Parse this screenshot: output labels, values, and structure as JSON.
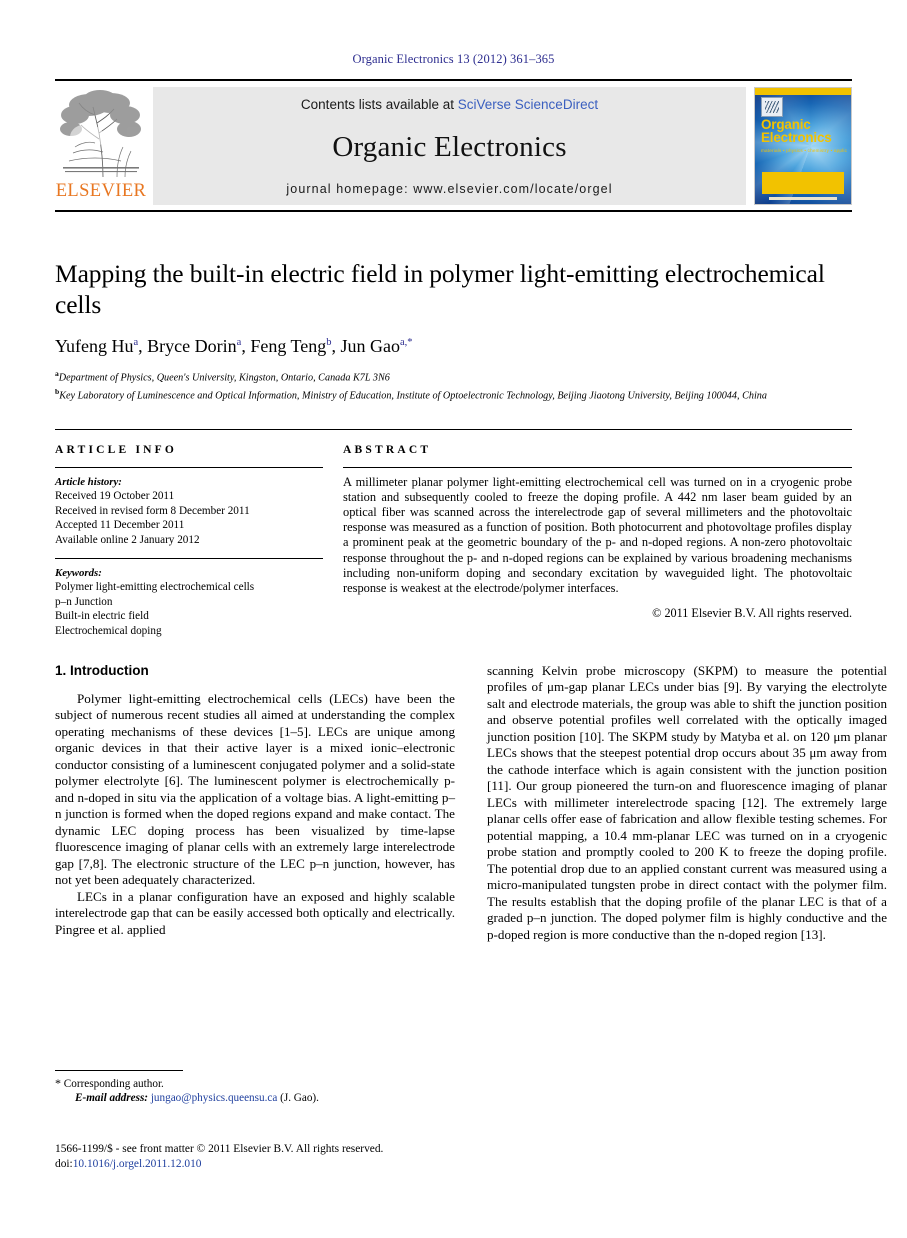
{
  "running_head": "Organic Electronics 13 (2012) 361–365",
  "masthead": {
    "publisher_name": "ELSEVIER",
    "contents_prefix": "Contents lists available at ",
    "contents_link": "SciVerse ScienceDirect",
    "journal_title": "Organic Electronics",
    "homepage_line": "journal homepage: www.elsevier.com/locate/orgel",
    "cover": {
      "title_line1": "Organic",
      "title_line2": "Electronics",
      "subtitle": "materials • physics • chemistry • applications"
    }
  },
  "article": {
    "title": "Mapping the built-in electric field in polymer light-emitting electrochemical cells",
    "authors": [
      {
        "name": "Yufeng Hu",
        "marks": "a",
        "sep": ", "
      },
      {
        "name": "Bryce Dorin",
        "marks": "a",
        "sep": ", "
      },
      {
        "name": "Feng Teng",
        "marks": "b",
        "sep": ", "
      },
      {
        "name": "Jun Gao",
        "marks": "a,*",
        "sep": ""
      }
    ],
    "affiliations": [
      {
        "mark": "a",
        "text": "Department of Physics, Queen's University, Kingston, Ontario, Canada K7L 3N6"
      },
      {
        "mark": "b",
        "text": "Key Laboratory of Luminescence and Optical Information, Ministry of Education, Institute of Optoelectronic Technology, Beijing Jiaotong University, Beijing 100044, China"
      }
    ]
  },
  "article_info": {
    "heading": "ARTICLE INFO",
    "history_label": "Article history:",
    "history": [
      "Received 19 October 2011",
      "Received in revised form 8 December 2011",
      "Accepted 11 December 2011",
      "Available online 2 January 2012"
    ],
    "keywords_label": "Keywords:",
    "keywords": [
      "Polymer light-emitting electrochemical cells",
      "p–n Junction",
      "Built-in electric field",
      "Electrochemical doping"
    ]
  },
  "abstract": {
    "heading": "ABSTRACT",
    "text": "A millimeter planar polymer light-emitting electrochemical cell was turned on in a cryogenic probe station and subsequently cooled to freeze the doping profile. A 442 nm laser beam guided by an optical fiber was scanned across the interelectrode gap of several millimeters and the photovoltaic response was measured as a function of position. Both photocurrent and photovoltage profiles display a prominent peak at the geometric boundary of the p- and n-doped regions. A non-zero photovoltaic response throughout the p- and n-doped regions can be explained by various broadening mechanisms including non-uniform doping and secondary excitation by waveguided light. The photovoltaic response is weakest at the electrode/polymer interfaces.",
    "copyright": "© 2011 Elsevier B.V. All rights reserved."
  },
  "body": {
    "section_title": "1. Introduction",
    "left_paragraphs": [
      "Polymer light-emitting electrochemical cells (LECs) have been the subject of numerous recent studies all aimed at understanding the complex operating mechanisms of these devices [1–5]. LECs are unique among organic devices in that their active layer is a mixed ionic–electronic conductor consisting of a luminescent conjugated polymer and a solid-state polymer electrolyte [6]. The luminescent polymer is electrochemically p- and n-doped in situ via the application of a voltage bias. A light-emitting p–n junction is formed when the doped regions expand and make contact. The dynamic LEC doping process has been visualized by time-lapse fluorescence imaging of planar cells with an extremely large interelectrode gap [7,8]. The electronic structure of the LEC p–n junction, however, has not yet been adequately characterized.",
      "LECs in a planar configuration have an exposed and highly scalable interelectrode gap that can be easily accessed both optically and electrically. Pingree et al. applied"
    ],
    "right_paragraphs": [
      "scanning Kelvin probe microscopy (SKPM) to measure the potential profiles of μm-gap planar LECs under bias [9]. By varying the electrolyte salt and electrode materials, the group was able to shift the junction position and observe potential profiles well correlated with the optically imaged junction position [10]. The SKPM study by Matyba et al. on 120 μm planar LECs shows that the steepest potential drop occurs about 35 μm away from the cathode interface which is again consistent with the junction position [11]. Our group pioneered the turn-on and fluorescence imaging of planar LECs with millimeter interelectrode spacing [12]. The extremely large planar cells offer ease of fabrication and allow flexible testing schemes. For potential mapping, a 10.4 mm-planar LEC was turned on in a cryogenic probe station and promptly cooled to 200 K to freeze the doping profile. The potential drop due to an applied constant current was measured using a micro-manipulated tungsten probe in direct contact with the polymer film. The results establish that the doping profile of the planar LEC is that of a graded p–n junction. The doped polymer film is highly conductive and the p-doped region is more conductive than the n-doped region [13]."
    ]
  },
  "footnote": {
    "corresponding_mark": "*",
    "corresponding_text": "Corresponding author.",
    "email_label": "E-mail address:",
    "email": "jungao@physics.queensu.ca",
    "email_suffix": "(J. Gao)."
  },
  "imprint": {
    "line1": "1566-1199/$ - see front matter © 2011 Elsevier B.V. All rights reserved.",
    "doi_label": "doi:",
    "doi": "10.1016/j.orgel.2011.12.010"
  },
  "colors": {
    "link": "#1f3f9e",
    "running_head": "#2d2d8f",
    "elsevier_orange": "#e87722",
    "cover_yellow": "#f2c200"
  }
}
